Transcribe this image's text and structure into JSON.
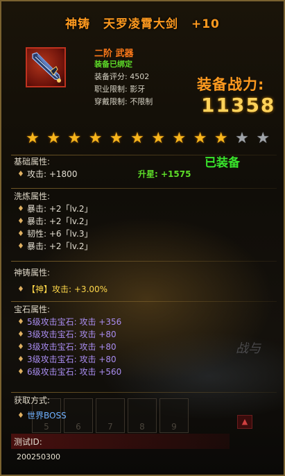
{
  "title": {
    "prefix": "神铸",
    "name": "天罗凌霄大剑",
    "enhance": "+10"
  },
  "item": {
    "icon": "greatsword-icon",
    "tier": "二阶  武器",
    "bound": "装备已绑定",
    "score": "装备评分: 4502",
    "class_limit": "职业限制: 影牙",
    "wear_limit": "穿戴限制: 不限制"
  },
  "power": {
    "label": "装备战力:",
    "value": "11358"
  },
  "stars": {
    "lit": 10,
    "total": 12
  },
  "status": "已装备",
  "base": {
    "title": "基础属性:",
    "attack": "攻击: +1800",
    "upstar": "升星: +1575"
  },
  "refine": {
    "title": "洗炼属性:",
    "lines": [
      "暴击: +2「lv.2」",
      "暴击: +2「lv.2」",
      "韧性: +6「lv.3」",
      "暴击: +2「lv.2」"
    ]
  },
  "forge": {
    "title": "神铸属性:",
    "tag": "【神】",
    "line": "攻击: +3.00%"
  },
  "gems": {
    "title": "宝石属性:",
    "lines": [
      "5级攻击宝石: 攻击 +356",
      "3级攻击宝石: 攻击 +80",
      "3级攻击宝石: 攻击 +80",
      "3级攻击宝石: 攻击 +80",
      "6级攻击宝石: 攻击 +560"
    ]
  },
  "source": {
    "title": "获取方式:",
    "line": "世界BOSS"
  },
  "slots": [
    "5",
    "6",
    "7",
    "8",
    "9"
  ],
  "background_text": "战与",
  "test_id": {
    "label": "测试ID:",
    "value": "200250300"
  },
  "colors": {
    "title": "#ff9a1f",
    "bound": "#5ddc28",
    "power": "#ffd25a",
    "star_on": "#f7b51c",
    "star_off": "#9fa3a8",
    "gem_text": "#a98cf0",
    "source_text": "#6fb1ff"
  }
}
